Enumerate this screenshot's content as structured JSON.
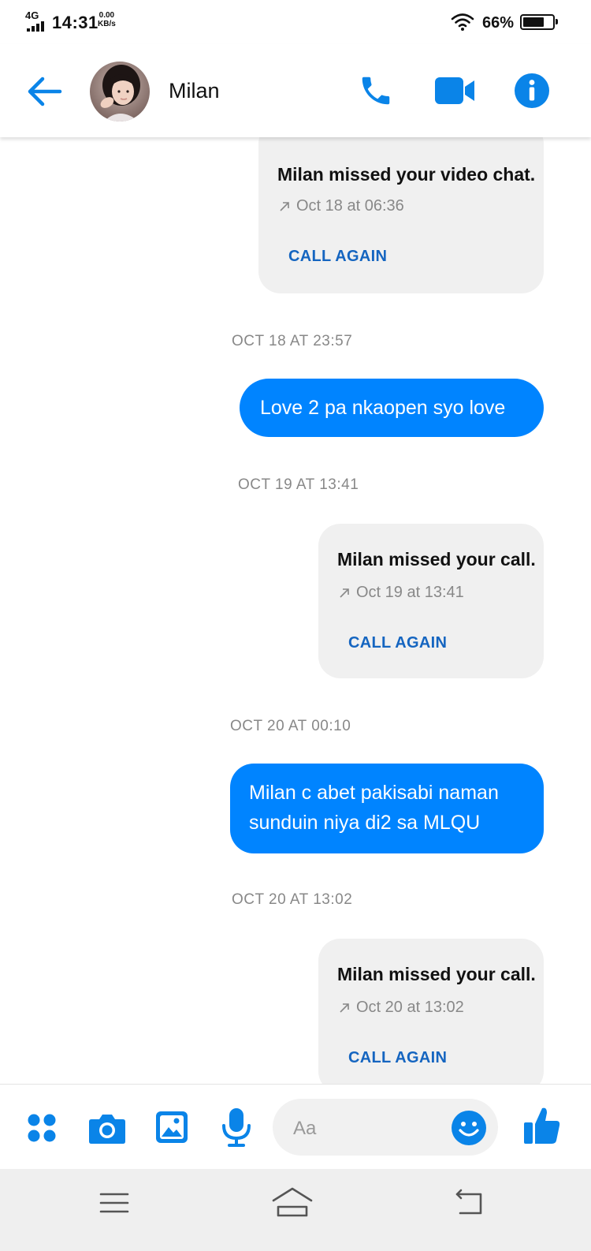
{
  "status_bar": {
    "network": "4G",
    "time": "14:31",
    "speed_value": "0.00",
    "speed_unit": "KB/s",
    "battery_percent": "66%",
    "battery_level": 0.66
  },
  "header": {
    "contact_name": "Milan",
    "icons": [
      "back-arrow-icon",
      "phone-icon",
      "video-camera-icon",
      "info-icon"
    ]
  },
  "thread": {
    "call_cards": [
      {
        "title": "Milan missed your video chat.",
        "time": "Oct 18 at 06:36",
        "action": "CALL AGAIN"
      },
      {
        "title": "Milan missed your call.",
        "time": "Oct 19 at 13:41",
        "action": "CALL AGAIN"
      },
      {
        "title": "Milan missed your call.",
        "time": "Oct 20 at 13:02",
        "action": "CALL AGAIN"
      }
    ],
    "timestamps": [
      "OCT 18 AT 23:57",
      "OCT 19 AT 13:41",
      "OCT 20 AT 00:10",
      "OCT 20 AT 13:02"
    ],
    "messages": [
      {
        "text": "Love 2 pa nkaopen syo love"
      },
      {
        "text": "Milan c abet pakisabi naman sunduin niya di2 sa MLQU"
      }
    ]
  },
  "composer": {
    "placeholder": "Aa",
    "icons": [
      "apps-icon",
      "camera-icon",
      "gallery-icon",
      "microphone-icon",
      "emoji-icon",
      "thumbs-up-icon"
    ]
  },
  "colors": {
    "accent": "#0084ff",
    "link": "#1565c0",
    "card_bg": "#f0f0f0",
    "muted_text": "#888888"
  }
}
